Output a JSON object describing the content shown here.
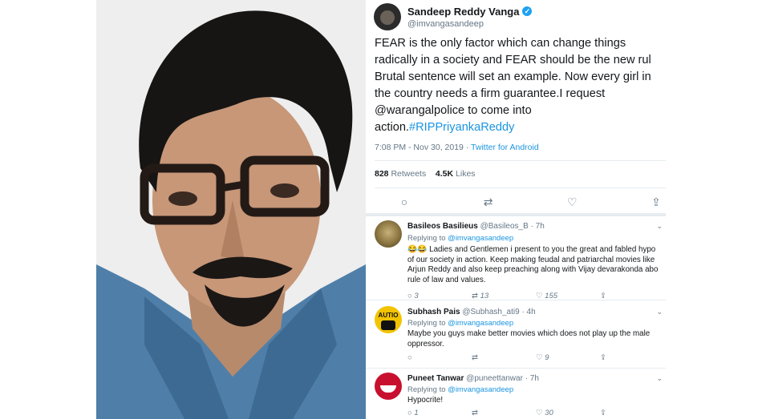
{
  "tweet": {
    "display_name": "Sandeep Reddy Vanga",
    "handle": "@imvangasandeep",
    "text_lines": [
      "FEAR is the only factor which can change things",
      "radically in a society and FEAR should be the new rul",
      "Brutal sentence will set an example. Now every girl in",
      "the country needs a firm guarantee.I request",
      "@warangalpolice to come into"
    ],
    "text_last_prefix": "action.",
    "hashtag": "#RIPPriyankaReddy",
    "time": "7:08 PM - Nov 30, 2019 ·",
    "source": "Twitter for Android",
    "retweets": "828",
    "retweets_label": "Retweets",
    "likes": "4.5K",
    "likes_label": "Likes"
  },
  "replies": [
    {
      "name": "Basileos Basilieus",
      "handle": "@Basileos_B · 7h",
      "replying_prefix": "Replying to",
      "replying_to": "@imvangasandeep",
      "text_lines": [
        "😂😂 Ladies and Gentlemen i present to you the great and fabled hypo",
        "of our society in action. Keep making feudal and patriarchal movies like",
        "Arjun Reddy and also keep preaching along with Vijay devarakonda abo",
        "rule of law and values."
      ],
      "reply_count": "3",
      "retweet_count": "13",
      "like_count": "155"
    },
    {
      "name": "Subhash Pais",
      "handle": "@Subhash_ati9 · 4h",
      "replying_prefix": "Replying to",
      "replying_to": "@imvangasandeep",
      "text_lines": [
        "Maybe you guys make better movies which does not play up the male",
        "oppressor."
      ],
      "reply_count": "",
      "retweet_count": "",
      "like_count": "9"
    },
    {
      "name": "Puneet Tanwar",
      "handle": "@puneettanwar · 7h",
      "replying_prefix": "Replying to",
      "replying_to": "@imvangasandeep",
      "text_lines": [
        "Hypocrite!"
      ],
      "reply_count": "1",
      "retweet_count": "",
      "like_count": "30"
    }
  ],
  "avatar_badge_text": "AUTIO"
}
